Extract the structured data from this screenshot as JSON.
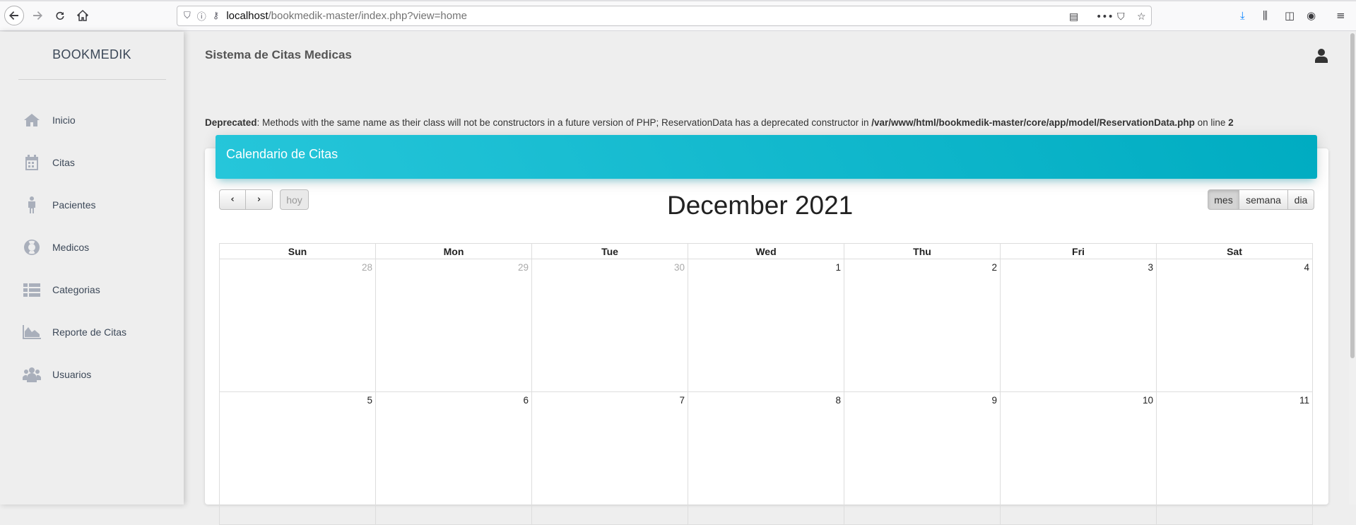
{
  "browser": {
    "url_host": "localhost",
    "url_path": "/bookmedik-master/index.php?view=home"
  },
  "sidebar": {
    "brand": "BOOKMEDIK",
    "items": [
      {
        "label": "Inicio",
        "icon": "home-icon"
      },
      {
        "label": "Citas",
        "icon": "calendar-icon"
      },
      {
        "label": "Pacientes",
        "icon": "person-icon"
      },
      {
        "label": "Medicos",
        "icon": "life-ring-icon"
      },
      {
        "label": "Categorias",
        "icon": "list-icon"
      },
      {
        "label": "Reporte de Citas",
        "icon": "area-chart-icon"
      },
      {
        "label": "Usuarios",
        "icon": "users-icon"
      }
    ]
  },
  "header": {
    "title": "Sistema de Citas Medicas"
  },
  "warning": {
    "label": "Deprecated",
    "text1": ": Methods with the same name as their class will not be constructors in a future version of PHP; ReservationData has a deprecated constructor in ",
    "path": "/var/www/html/bookmedik-master/core/app/model/ReservationData.php",
    "text2": " on line ",
    "line": "2"
  },
  "calendar": {
    "card_title": "Calendario de Citas",
    "prev": "‹",
    "next": "›",
    "today": "hoy",
    "title": "December 2021",
    "views": [
      "mes",
      "semana",
      "dia"
    ],
    "active_view": "mes",
    "weekdays": [
      "Sun",
      "Mon",
      "Tue",
      "Wed",
      "Thu",
      "Fri",
      "Sat"
    ],
    "weeks": [
      [
        "28",
        "29",
        "30",
        "1",
        "2",
        "3",
        "4"
      ],
      [
        "5",
        "6",
        "7",
        "8",
        "9",
        "10",
        "11"
      ]
    ]
  }
}
